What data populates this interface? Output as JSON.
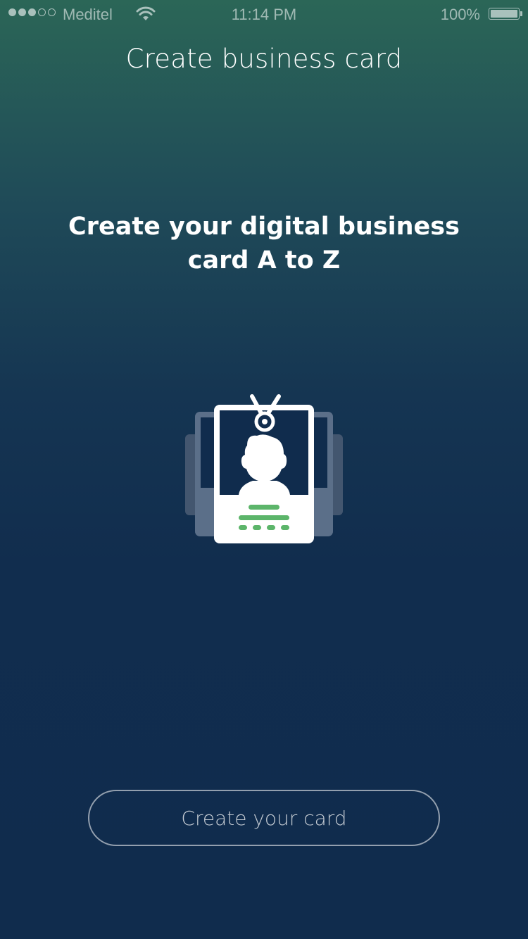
{
  "status_bar": {
    "carrier": "Meditel",
    "time": "11:14 PM",
    "battery_percent": "100%",
    "signal_bars_filled": 3,
    "signal_bars_total": 5
  },
  "header": {
    "title": "Create business card"
  },
  "main": {
    "headline": "Create your digital business card A to Z",
    "illustration_icon": "id-badge-icon",
    "cta_label": "Create your card"
  },
  "colors": {
    "gradient_top": "#2b6657",
    "gradient_bottom": "#102c4d",
    "accent_green": "#5cb56a",
    "card_white": "#ffffff",
    "card_back": "#5b6f89"
  }
}
